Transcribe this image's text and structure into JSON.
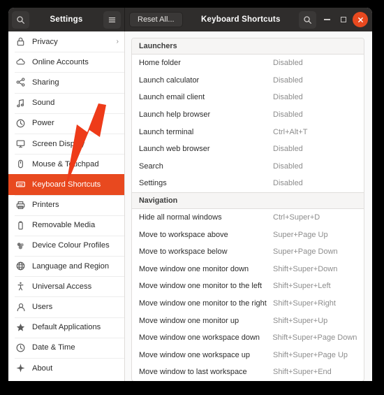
{
  "window": {
    "app_title": "Settings",
    "page_title": "Keyboard Shortcuts",
    "reset_label": "Reset All...",
    "accent_color": "#e8491f",
    "titlebar_color": "#2f2d2c",
    "icons": {
      "app_search": "search-icon",
      "menu": "hamburger-menu-icon",
      "page_search": "search-icon",
      "minimize": "minimize-icon",
      "maximize": "maximize-icon",
      "close": "close-icon"
    }
  },
  "sidebar": {
    "items": [
      {
        "label": "Privacy",
        "icon": "lock-icon",
        "chevron": "›",
        "selected": false
      },
      {
        "label": "Online Accounts",
        "icon": "cloud-icon",
        "chevron": "",
        "selected": false
      },
      {
        "label": "Sharing",
        "icon": "share-icon",
        "chevron": "",
        "selected": false
      },
      {
        "label": "Sound",
        "icon": "music-note-icon",
        "chevron": "",
        "selected": false
      },
      {
        "label": "Power",
        "icon": "power-icon",
        "chevron": "",
        "selected": false
      },
      {
        "label": "Screen Display",
        "icon": "monitor-icon",
        "chevron": "",
        "selected": false
      },
      {
        "label": "Mouse & Touchpad",
        "icon": "mouse-icon",
        "chevron": "",
        "selected": false
      },
      {
        "label": "Keyboard Shortcuts",
        "icon": "keyboard-icon",
        "chevron": "",
        "selected": true
      },
      {
        "label": "Printers",
        "icon": "printer-icon",
        "chevron": "",
        "selected": false
      },
      {
        "label": "Removable Media",
        "icon": "usb-drive-icon",
        "chevron": "",
        "selected": false
      },
      {
        "label": "Device Colour Profiles",
        "icon": "colour-profile-icon",
        "chevron": "",
        "selected": false
      },
      {
        "label": "Language and Region",
        "icon": "globe-icon",
        "chevron": "",
        "selected": false
      },
      {
        "label": "Universal Access",
        "icon": "accessibility-icon",
        "chevron": "",
        "selected": false
      },
      {
        "label": "Users",
        "icon": "users-icon",
        "chevron": "",
        "selected": false
      },
      {
        "label": "Default Applications",
        "icon": "star-icon",
        "chevron": "",
        "selected": false
      },
      {
        "label": "Date & Time",
        "icon": "clock-icon",
        "chevron": "",
        "selected": false
      },
      {
        "label": "About",
        "icon": "info-diamond-icon",
        "chevron": "",
        "selected": false
      }
    ]
  },
  "main": {
    "sections": [
      {
        "title": "Launchers",
        "rows": [
          {
            "name": "Home folder",
            "value": "Disabled"
          },
          {
            "name": "Launch calculator",
            "value": "Disabled"
          },
          {
            "name": "Launch email client",
            "value": "Disabled"
          },
          {
            "name": "Launch help browser",
            "value": "Disabled"
          },
          {
            "name": "Launch terminal",
            "value": "Ctrl+Alt+T"
          },
          {
            "name": "Launch web browser",
            "value": "Disabled"
          },
          {
            "name": "Search",
            "value": "Disabled"
          },
          {
            "name": "Settings",
            "value": "Disabled"
          }
        ]
      },
      {
        "title": "Navigation",
        "rows": [
          {
            "name": "Hide all normal windows",
            "value": "Ctrl+Super+D"
          },
          {
            "name": "Move to workspace above",
            "value": "Super+Page Up"
          },
          {
            "name": "Move to workspace below",
            "value": "Super+Page Down"
          },
          {
            "name": "Move window one monitor down",
            "value": "Shift+Super+Down"
          },
          {
            "name": "Move window one monitor to the left",
            "value": "Shift+Super+Left"
          },
          {
            "name": "Move window one monitor to the right",
            "value": "Shift+Super+Right"
          },
          {
            "name": "Move window one monitor up",
            "value": "Shift+Super+Up"
          },
          {
            "name": "Move window one workspace down",
            "value": "Shift+Super+Page Down"
          },
          {
            "name": "Move window one workspace up",
            "value": "Shift+Super+Page Up"
          },
          {
            "name": "Move window to last workspace",
            "value": "Shift+Super+End"
          }
        ]
      }
    ]
  },
  "annotation": {
    "arrow_color": "#ee3b19",
    "points_to": "Keyboard Shortcuts"
  }
}
